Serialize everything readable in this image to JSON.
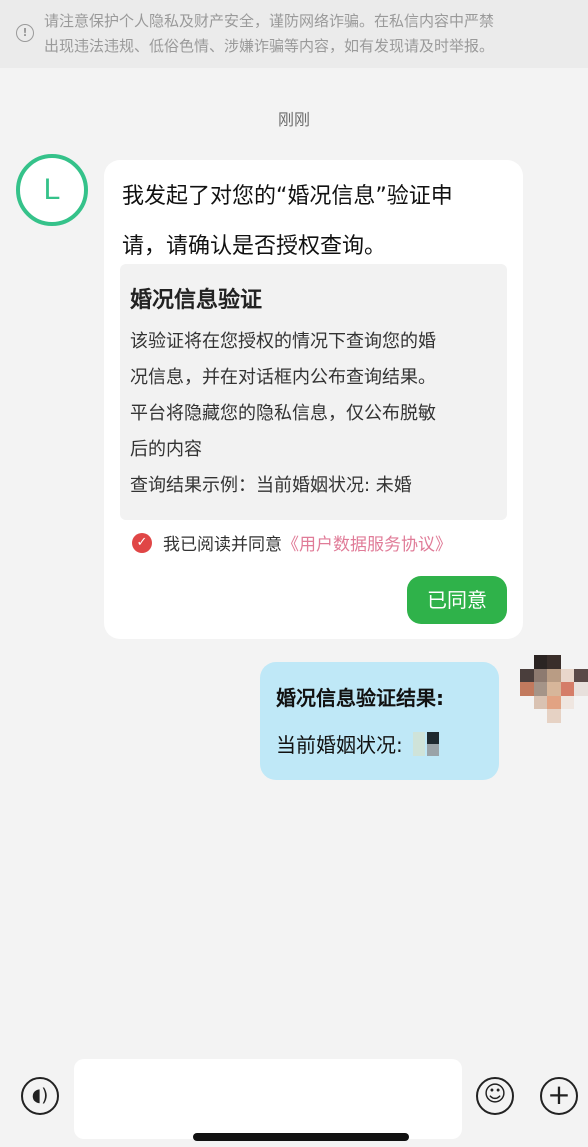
{
  "notice": {
    "line1": "请注意保护个人隐私及财产安全，谨防网络诈骗。在私信内容中严禁",
    "line2": "出现违法违规、低俗色情、涉嫌诈骗等内容，如有发现请及时举报。"
  },
  "timestamp": "刚刚",
  "sender_avatar": {
    "letter": "L",
    "color": "#35c28a"
  },
  "request_message": {
    "text_line1": "我发起了对您的“婚况信息”验证申",
    "text_line2": "请，请确认是否授权查询。",
    "card": {
      "title": "婚况信息验证",
      "body_line1": "该验证将在您授权的情况下查询您的婚",
      "body_line2": "况信息，并在对话框内公布查询结果。",
      "body_line3": "平台将隐藏您的隐私信息，仅公布脱敏",
      "body_line4": "后的内容",
      "example": "查询结果示例：当前婚姻状况: 未婚"
    },
    "agreement_text": "我已阅读并同意",
    "agreement_link": "《用户数据服务协议》",
    "button_label": "已同意",
    "button_color": "#2fb24a"
  },
  "reply_message": {
    "title": "婚况信息验证结果:",
    "status_label": "当前婚姻状况:"
  },
  "colors": {
    "background": "#f3f3f3",
    "reply_bubble": "#bfe8f7",
    "link": "#e07c98",
    "check": "#e04646"
  },
  "icons": {
    "notice": "info-circle-icon",
    "check": "check-circle-icon",
    "voice": "voice-icon",
    "emoji": "emoji-icon",
    "plus": "plus-icon"
  }
}
